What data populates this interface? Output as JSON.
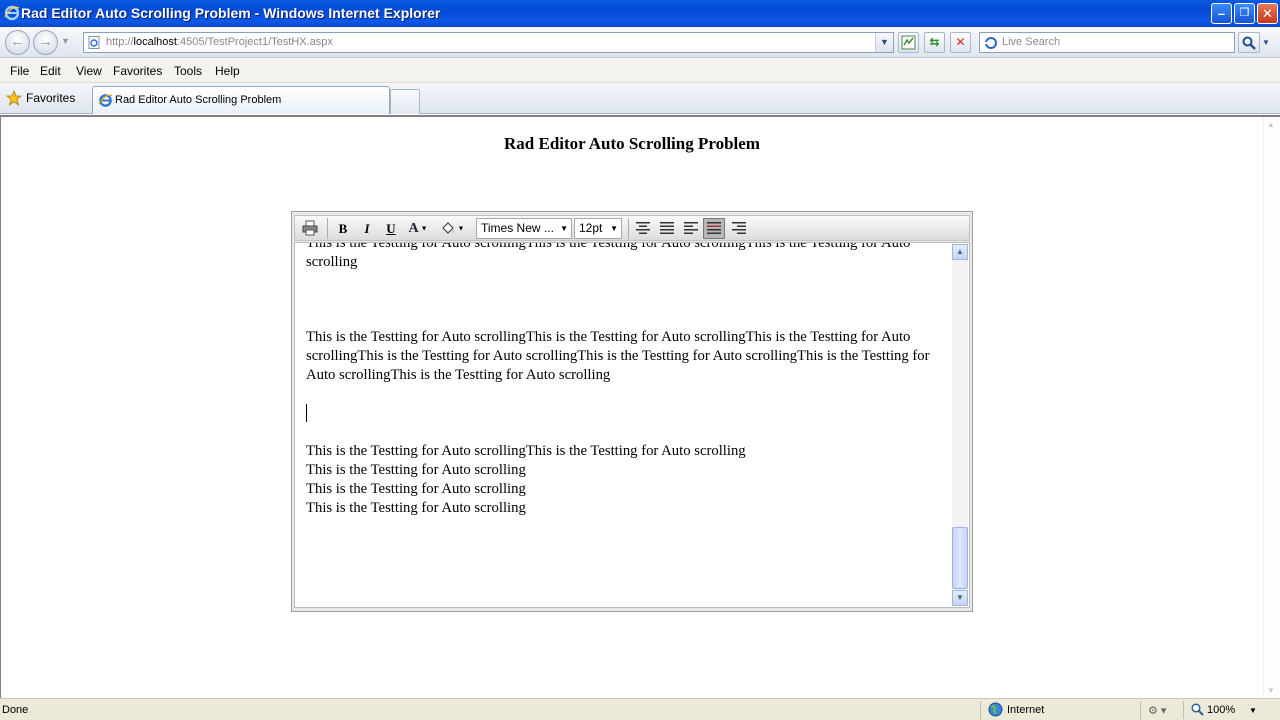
{
  "window": {
    "title": "Rad Editor Auto Scrolling Problem - Windows Internet Explorer",
    "minimize_label": "–",
    "restore_label": "❐",
    "close_label": "✕"
  },
  "address": {
    "url_prefix": "http://",
    "url_host": "localhost",
    "url_rest": ":4505/TestProject1/TestHX.aspx"
  },
  "search": {
    "placeholder": "Live Search"
  },
  "menu": [
    "File",
    "Edit",
    "View",
    "Favorites",
    "Tools",
    "Help"
  ],
  "favorites": {
    "label": "Favorites"
  },
  "tabs": [
    {
      "label": "Rad Editor Auto Scrolling Problem"
    }
  ],
  "page": {
    "heading": "Rad Editor Auto Scrolling Problem"
  },
  "editor": {
    "toolbar": {
      "bold": "B",
      "italic": "I",
      "underline": "U",
      "forecolor": "A",
      "font_name": "Times New ...",
      "font_size": "12pt"
    },
    "paragraphs": [
      "This is the Testting for Auto scrollingThis is the Testting for Auto scrollingThis is the Testting for Auto scrolling",
      "This is the Testting for Auto scrollingThis is the Testting for Auto scrollingThis is the Testting for Auto scrollingThis is the Testting for Auto scrollingThis is the Testting for Auto scrollingThis is the Testting for Auto scrollingThis is the Testting for Auto scrolling",
      "This is the Testting for Auto scrollingThis is the Testting for Auto scrolling",
      "This is the Testting for Auto scrolling",
      "This is the Testting for Auto scrolling",
      "This is the Testting for Auto scrolling"
    ]
  },
  "status": {
    "text": "Done",
    "zone": "Internet",
    "zoom": "100%"
  },
  "colors": {
    "titlebar": "#0a5be0",
    "scroll_thumb": "#c6d6f8"
  }
}
